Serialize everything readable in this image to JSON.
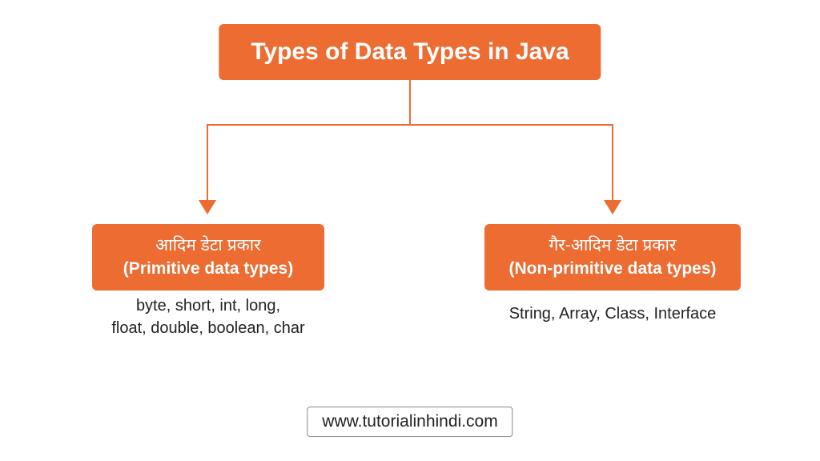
{
  "title": "Types of Data Types in Java",
  "left": {
    "hindi": "आदिम डेटा प्रकार",
    "english": "(Primitive data types)",
    "examples_line1": "byte, short, int, long,",
    "examples_line2": "float, double, boolean, char"
  },
  "right": {
    "hindi": "गैर-आदिम डेटा प्रकार",
    "english": "(Non-primitive data types)",
    "examples": "String, Array, Class, Interface"
  },
  "footer": "www.tutorialinhindi.com"
}
